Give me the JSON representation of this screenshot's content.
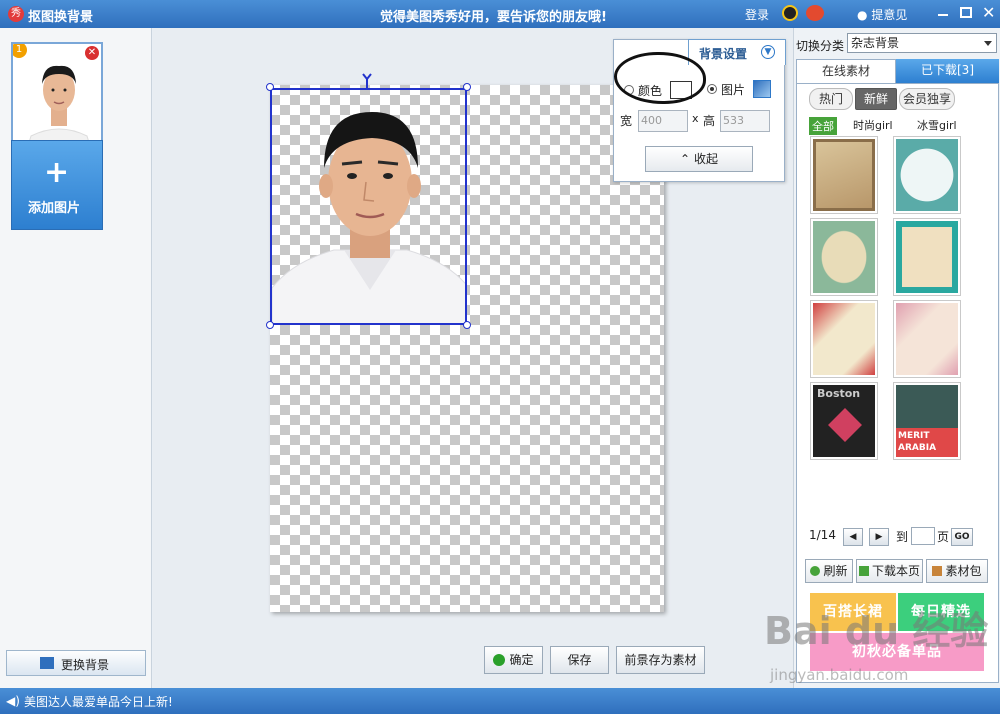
{
  "window": {
    "title": "抠图换背景",
    "slogan": "觉得美图秀秀好用，要告诉您的朋友哦!",
    "login": "登录",
    "feedback": "提意见",
    "logo_char": "秀"
  },
  "left": {
    "thumb_badge": "1",
    "add_label": "添加图片",
    "change_bg_label": "更换背景"
  },
  "canvas": {
    "buttons": {
      "confirm": "确定",
      "save": "保存",
      "save_as_material": "前景存为素材"
    }
  },
  "bg_settings": {
    "tab_label": "背景设置",
    "color_label": "颜色",
    "image_label": "图片",
    "selected": "图片",
    "width_label": "宽",
    "width_value": "400",
    "x_label": "x",
    "height_label": "高",
    "height_value": "533",
    "collapse_label": "收起"
  },
  "right": {
    "category_label": "切换分类",
    "category_value": "杂志背景",
    "tabs": [
      {
        "label": "在线素材",
        "active": true
      },
      {
        "label": "已下载[3]",
        "active": false
      }
    ],
    "filters": [
      {
        "label": "热门",
        "selected": false
      },
      {
        "label": "新鲜",
        "selected": true
      },
      {
        "label": "会员独享",
        "selected": false
      }
    ],
    "subfilters": [
      {
        "label": "全部",
        "selected": true
      },
      {
        "label": "时尚girl",
        "selected": false
      },
      {
        "label": "冰雪girl",
        "selected": false
      }
    ],
    "thumbnails": [
      {
        "name": "vintage-paper",
        "colors": [
          "#d9c49a",
          "#b8976a"
        ]
      },
      {
        "name": "floral-teal",
        "colors": [
          "#e8f2f2",
          "#5aaba8"
        ]
      },
      {
        "name": "green-oval",
        "colors": [
          "#e8dcb8",
          "#8bb89a"
        ]
      },
      {
        "name": "teal-frame",
        "colors": [
          "#f0e0c0",
          "#2aa8a0"
        ]
      },
      {
        "name": "floral-red",
        "colors": [
          "#f2e8cc",
          "#d04040"
        ]
      },
      {
        "name": "pink-floral",
        "colors": [
          "#f5e4d8",
          "#e0a0b0"
        ]
      },
      {
        "name": "boston-heart",
        "colors": [
          "#222222",
          "#d04060"
        ]
      },
      {
        "name": "merit-sculpture",
        "colors": [
          "#3b5a56",
          "#e04848"
        ]
      }
    ],
    "pager": {
      "page_text": "1/14",
      "to_label": "到",
      "page_label": "页",
      "go_label": "GO"
    },
    "tools": {
      "refresh": "刷新",
      "download_page": "下载本页",
      "material_pack": "素材包"
    },
    "promos": [
      {
        "label": "百搭长裙",
        "color": "#f8c24e"
      },
      {
        "label": "每日精选",
        "color": "#3ccf7d"
      },
      {
        "label": "初秋必备单品",
        "color": "#f79bc7"
      }
    ],
    "thumb_texts": {
      "boston": "Boston",
      "merit": "MERIT",
      "arabia": "ARABIA"
    }
  },
  "status": {
    "message": "美图达人最爱单品今日上新!"
  },
  "watermark": {
    "main": "Bai du 经验",
    "sub": "jingyan.baidu.com"
  },
  "colors": {
    "accent": "#2f6fbd",
    "selection": "#2233cc"
  }
}
